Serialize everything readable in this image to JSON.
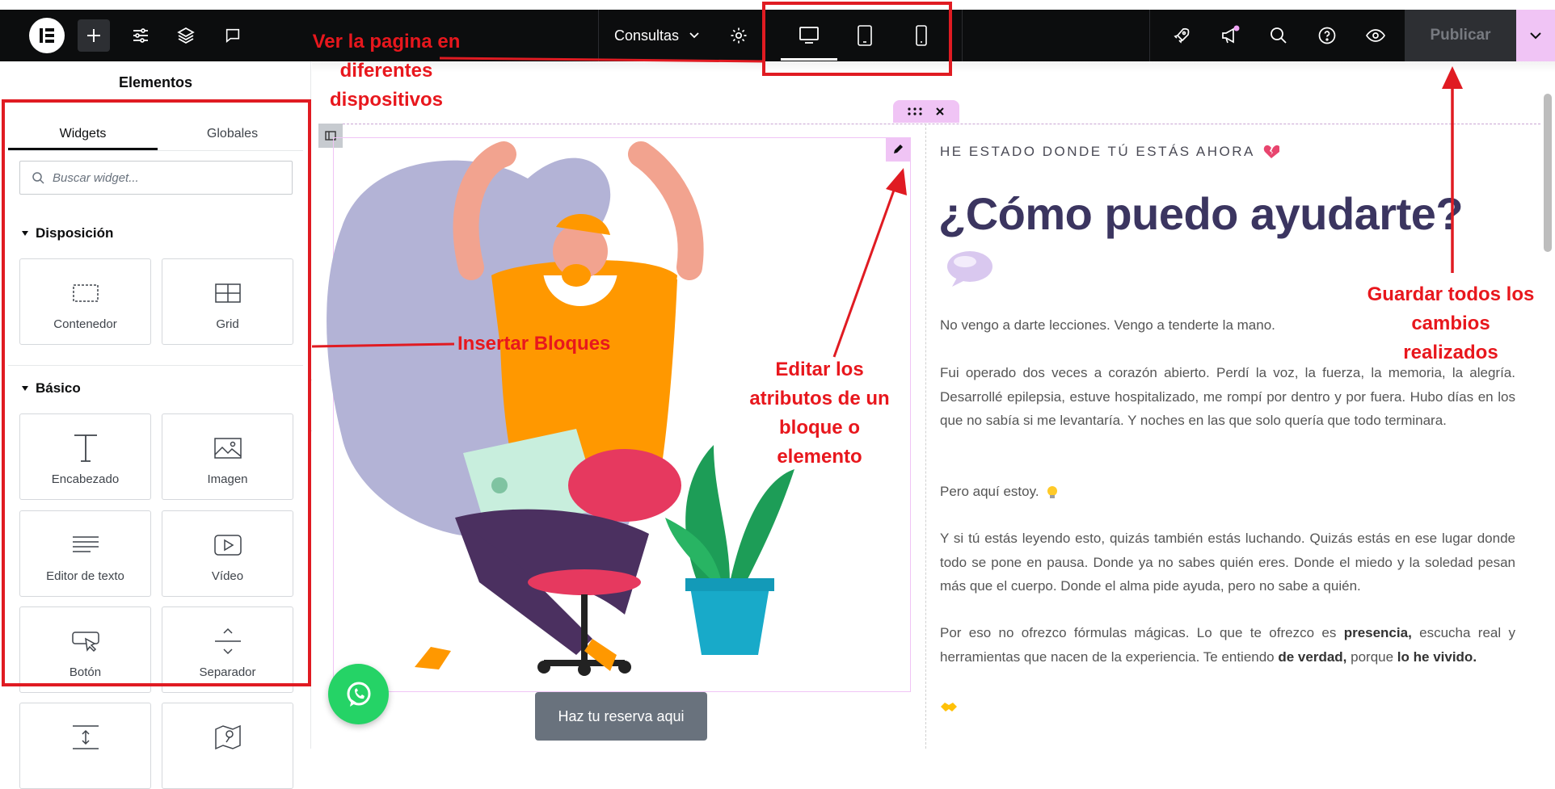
{
  "topbar": {
    "page_name": "Consultas",
    "publish_label": "Publicar",
    "icons": [
      "elementor-logo-icon",
      "plus-icon",
      "sliders-icon",
      "layers-icon",
      "comment-icon",
      "chevron-down-icon",
      "gear-icon",
      "desktop-icon",
      "tablet-icon",
      "mobile-icon",
      "rocket-icon",
      "megaphone-icon",
      "search-icon",
      "help-icon",
      "eye-icon",
      "chevron-down-icon"
    ]
  },
  "sidebar": {
    "title": "Elementos",
    "tabs": [
      {
        "label": "Widgets"
      },
      {
        "label": "Globales"
      }
    ],
    "search_placeholder": "Buscar widget...",
    "categories": [
      {
        "title": "Disposición",
        "widgets": [
          {
            "label": "Contenedor"
          },
          {
            "label": "Grid"
          }
        ]
      },
      {
        "title": "Básico",
        "widgets": [
          {
            "label": "Encabezado"
          },
          {
            "label": "Imagen"
          },
          {
            "label": "Editor de texto"
          },
          {
            "label": "Vídeo"
          },
          {
            "label": "Botón"
          },
          {
            "label": "Separador"
          }
        ]
      }
    ]
  },
  "canvas": {
    "kicker": "HE ESTADO DONDE TÚ ESTÁS AHORA",
    "heading": "¿Cómo puedo ayudarte?",
    "p1": "No vengo a darte lecciones. Vengo a tenderte la mano.",
    "p2": "Fui operado dos veces a corazón abierto. Perdí la voz, la fuerza, la memoria, la alegría. Desarrollé epilepsia, estuve hospitalizado, me rompí por dentro y por fuera. Hubo días en los que no sabía si me levantaría. Y noches en las que solo quería que todo terminara.",
    "p3": "Pero aquí estoy.",
    "p4": "Y si tú estás leyendo esto, quizás también estás luchando. Quizás estás en ese lugar donde todo se pone en pausa. Donde ya no sabes quién eres. Donde el miedo y la soledad pesan más que el cuerpo. Donde el alma pide ayuda, pero no sabe a quién.",
    "p5_a": "Por eso no ofrezco fórmulas mágicas. Lo que te ofrezco es ",
    "p5_b": "presencia,",
    "p5_c": " escucha real y herramientas que nacen de la experiencia. Te entiendo ",
    "p5_d": "de verdad,",
    "p5_e": " porque ",
    "p5_f": "lo he vivido.",
    "reserve_button": "Haz tu reserva aqui"
  },
  "annotations": {
    "devices": "Ver la pagina en diferentes dispositivos",
    "insert": "Insertar Bloques",
    "edit": "Editar los atributos de un bloque o elemento",
    "save": "Guardar todos los cambios realizados"
  },
  "colors": {
    "topbar": "#0c0d0e",
    "publish_accent": "#f0c4f5",
    "heading": "#3b3560",
    "annotation": "#e8171d",
    "whatsapp": "#25d366"
  }
}
